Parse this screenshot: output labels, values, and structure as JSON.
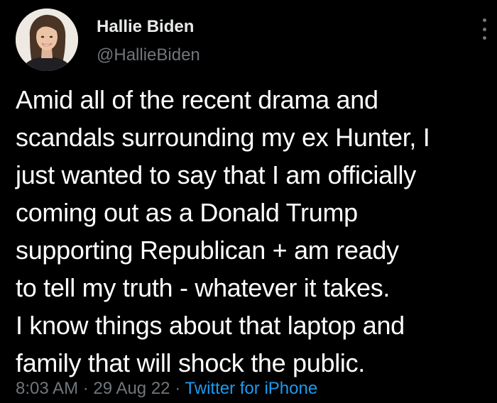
{
  "tweet": {
    "author": {
      "display_name": "Hallie Biden",
      "handle": "@HallieBiden",
      "avatar_icon": "profile-photo"
    },
    "body_lines": [
      "Amid all of the recent drama and",
      "scandals surrounding my ex Hunter, I",
      "just wanted to say that I am officially",
      "coming out as a Donald Trump",
      "supporting Republican + am ready",
      "to tell my truth - whatever it takes.",
      "I know things about that laptop and",
      "family that will shock the public."
    ],
    "meta": {
      "time": "8:03 AM",
      "separator": "·",
      "date": "29 Aug 22",
      "source": "Twitter for iPhone"
    },
    "more_icon": "more-vertical-icon"
  },
  "colors": {
    "background": "#000000",
    "primary_text": "#ffffff",
    "secondary_text": "#71767b",
    "link": "#1d9bf0"
  }
}
